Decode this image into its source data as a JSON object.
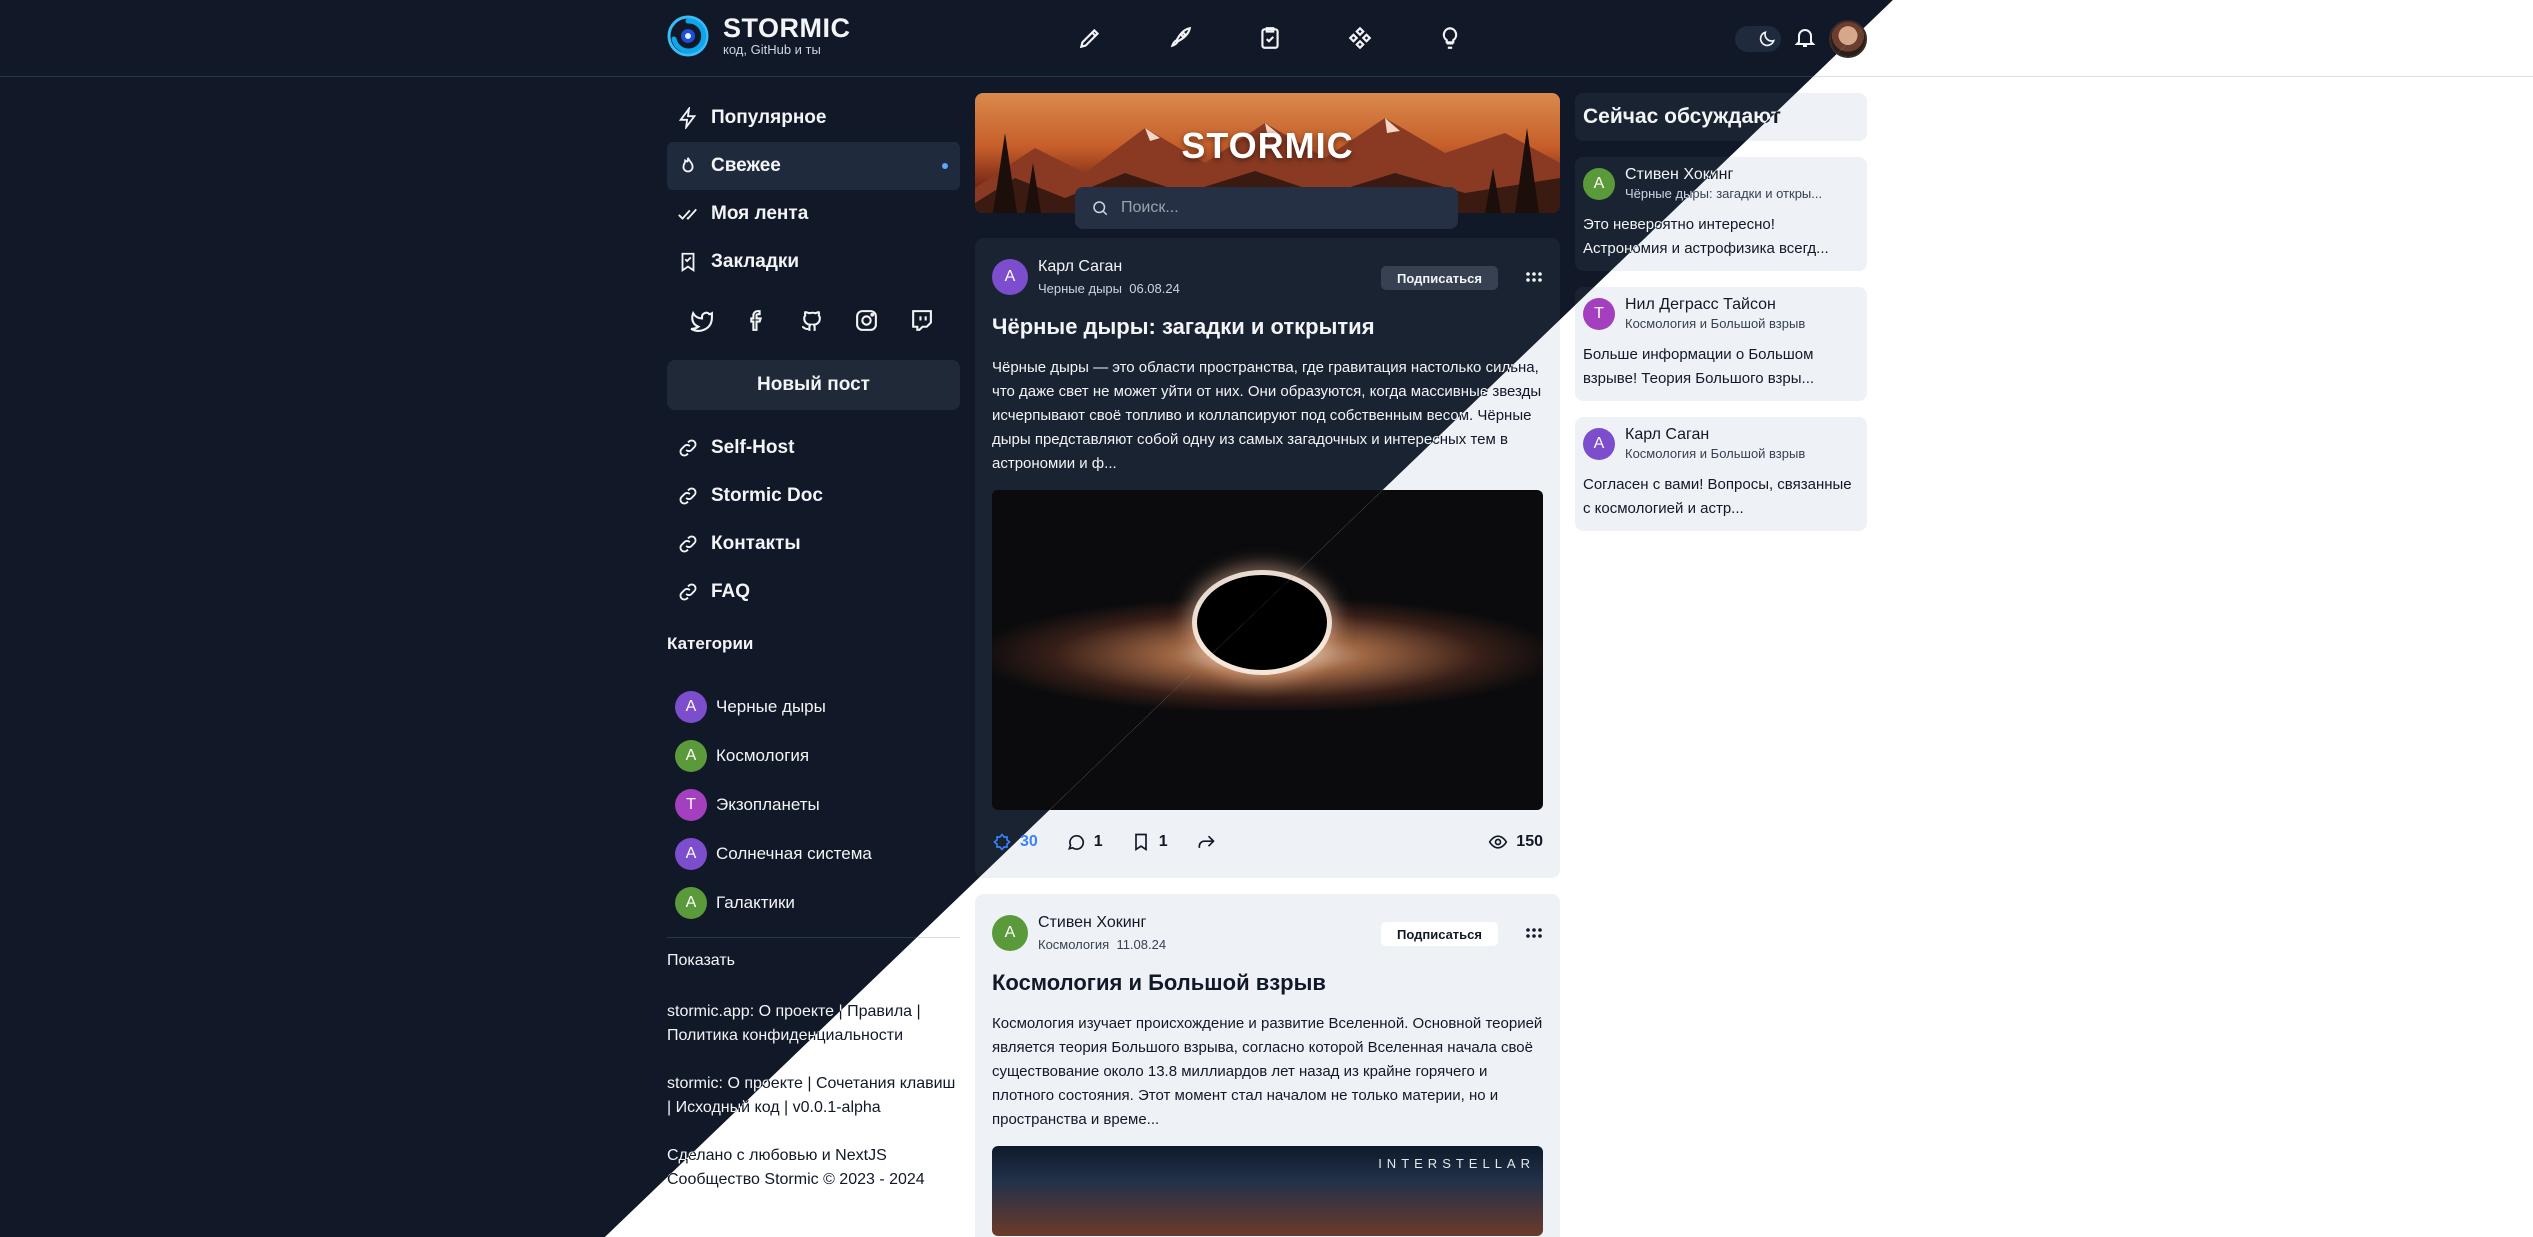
{
  "brand": {
    "title": "STORMIC",
    "subtitle": "код, GitHub и ты"
  },
  "header": {
    "nav_icons": [
      "pencil-icon",
      "rocket-icon",
      "checklist-icon",
      "grid-icon",
      "lightbulb-icon"
    ],
    "right_icons": [
      "moon-icon",
      "bell-icon",
      "user-avatar"
    ]
  },
  "sidebar": {
    "menu": [
      {
        "label": "Популярное",
        "icon": "lightning-icon"
      },
      {
        "label": "Свежее",
        "icon": "flame-icon",
        "active": true
      },
      {
        "label": "Моя лента",
        "icon": "double-check-icon"
      },
      {
        "label": "Закладки",
        "icon": "bookmark-icon"
      }
    ],
    "socials": [
      "twitter-icon",
      "facebook-icon",
      "github-icon",
      "instagram-icon",
      "twitch-icon"
    ],
    "new_post": "Новый пост",
    "links": [
      {
        "label": "Self-Host",
        "icon": "link-icon"
      },
      {
        "label": "Stormic Doc",
        "icon": "link-icon"
      },
      {
        "label": "Контакты",
        "icon": "link-icon"
      },
      {
        "label": "FAQ",
        "icon": "link-icon"
      }
    ],
    "categories_title": "Категории",
    "categories": [
      {
        "letter": "A",
        "label": "Черные дыры",
        "color": "#7c4dcc"
      },
      {
        "letter": "A",
        "label": "Космология",
        "color": "#5a9a3a"
      },
      {
        "letter": "T",
        "label": "Экзопланеты",
        "color": "#a43fbf"
      },
      {
        "letter": "A",
        "label": "Солнечная система",
        "color": "#7c4dcc"
      },
      {
        "letter": "A",
        "label": "Галактики",
        "color": "#5a9a3a"
      }
    ],
    "show_label": "Показать",
    "footer": {
      "line1": "stormic.app: О проекте | Правила | Политика конфиденциальности",
      "line2": "stormic: О проекте | Сочетания клавиш | Исходный код | v0.0.1-alpha",
      "line3": "Сделано с любовью и NextJS",
      "line4": "Сообщество Stormic © 2023 - 2024"
    }
  },
  "feed": {
    "banner_title": "STORMIC",
    "search_placeholder": "Поиск...",
    "posts": [
      {
        "avatar_letter": "A",
        "avatar_color": "#7c4dcc",
        "author": "Карл Саган",
        "category": "Черные дыры",
        "date": "06.08.24",
        "subscribe": "Подписаться",
        "title": "Чёрные дыры: загадки и открытия",
        "text": "Чёрные дыры — это области пространства, где гравитация настолько сильна, что даже свет не может уйти от них. Они образуются, когда массивные звезды исчерпывают своё топливо и коллапсируют под собственным весом. Чёрные дыры представляют собой одну из самых загадочных и интересных тем в астрономии и ф...",
        "likes": "30",
        "comments": "1",
        "bookmarks": "1",
        "views": "150"
      },
      {
        "avatar_letter": "A",
        "avatar_color": "#5a9a3a",
        "author": "Стивен Хокинг",
        "category": "Космология",
        "date": "11.08.24",
        "subscribe": "Подписаться",
        "title": "Космология и Большой взрыв",
        "text": "Космология изучает происхождение и развитие Вселенной. Основной теорией является теория Большого взрыва, согласно которой Вселенная начала своё существование около 13.8 миллиардов лет назад из крайне горячего и плотного состояния. Этот момент стал началом не только материи, но и пространства и време...",
        "image_caption": "INTERSTELLAR"
      }
    ]
  },
  "discussion": {
    "title": "Сейчас обсуждают",
    "items": [
      {
        "letter": "A",
        "color": "#5a9a3a",
        "author": "Стивен Хокинг",
        "post": "Чёрные дыры: загадки и откры...",
        "text": "Это невероятно интересно! Астрономия и астрофизика всегд..."
      },
      {
        "letter": "T",
        "color": "#a43fbf",
        "author": "Нил Деграсс Тайсон",
        "post": "Космология и Большой взрыв",
        "text": "Больше информации о Большом взрыве! Теория Большого взры..."
      },
      {
        "letter": "A",
        "color": "#7c4dcc",
        "author": "Карл Саган",
        "post": "Космология и Большой взрыв",
        "text": "Согласен с вами! Вопросы, связанные с космологией и астр..."
      }
    ]
  }
}
